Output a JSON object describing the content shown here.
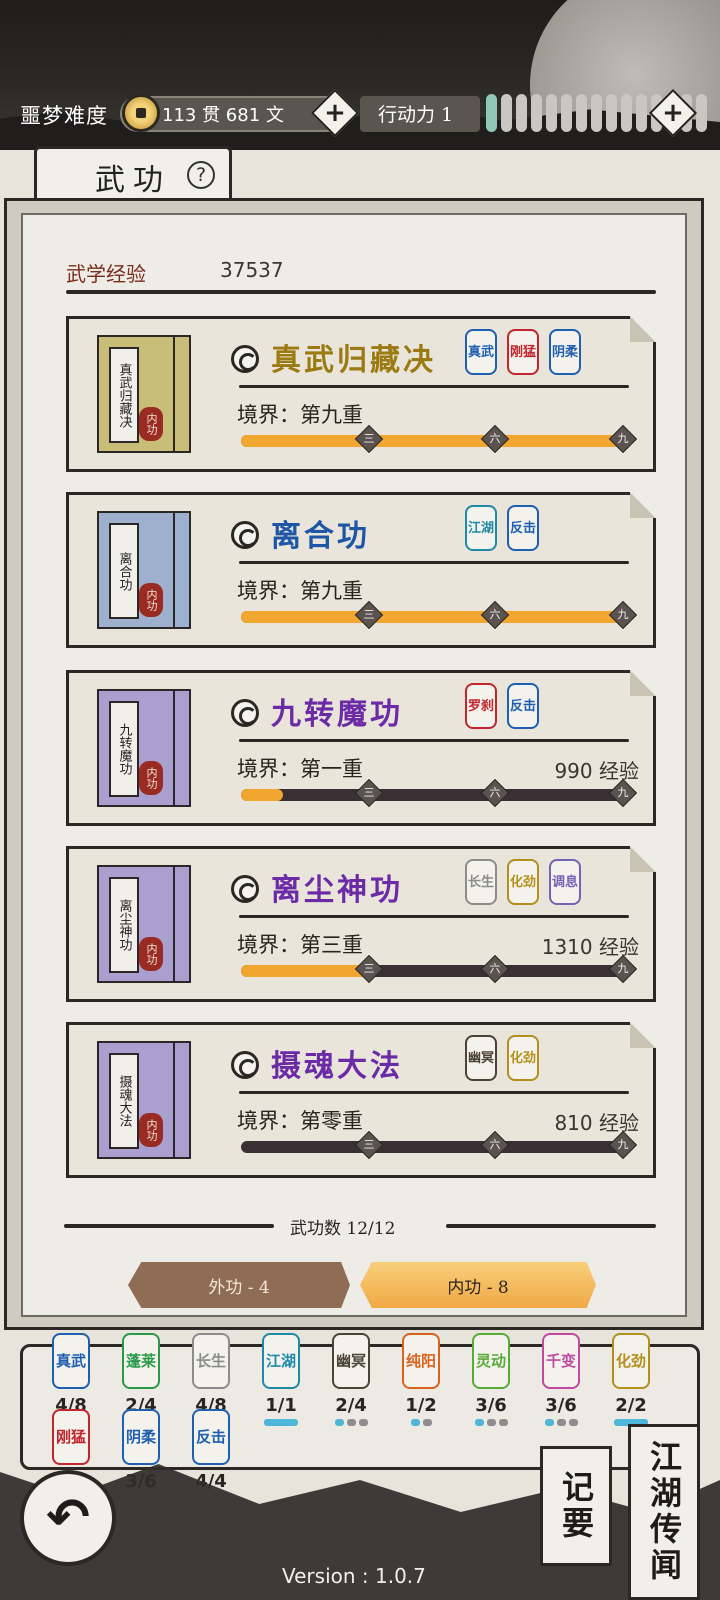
{
  "status": {
    "difficulty": "噩梦难度",
    "currency": "113 贯  681  文",
    "action_label": "行动力 1",
    "energy_total": 15,
    "energy_filled": 1
  },
  "page": {
    "title": "武功",
    "help_glyph": "?"
  },
  "experience": {
    "label": "武学经验",
    "value": "37537"
  },
  "realm_label": "境界：",
  "marks": [
    "三",
    "六",
    "九"
  ],
  "skills": [
    {
      "name": "真武归藏决",
      "name_color": "#9b7a12",
      "book_label": "真武归藏决",
      "book_color": "#c9bd7a",
      "seal": "内功",
      "realm": "第九重",
      "exp": "",
      "exp_unit": "",
      "progress": 1.0,
      "tags": [
        {
          "text": "真武",
          "color": "#1f5fb0"
        },
        {
          "text": "刚猛",
          "color": "#c0262c"
        },
        {
          "text": "阴柔",
          "color": "#1f5fb0"
        }
      ]
    },
    {
      "name": "离合功",
      "name_color": "#1d56a6",
      "book_label": "离合功",
      "book_color": "#9db1cf",
      "seal": "内功",
      "realm": "第九重",
      "exp": "",
      "exp_unit": "",
      "progress": 1.0,
      "tags": [
        {
          "text": "江湖",
          "color": "#1f8aa8"
        },
        {
          "text": "反击",
          "color": "#1f5fb0"
        }
      ]
    },
    {
      "name": "九转魔功",
      "name_color": "#6b2aa6",
      "book_label": "九转魔功",
      "book_color": "#aaa0cf",
      "seal": "内功",
      "realm": "第一重",
      "exp": "990",
      "exp_unit": " 经验",
      "progress": 0.11,
      "tags": [
        {
          "text": "罗刹",
          "color": "#c0262c"
        },
        {
          "text": "反击",
          "color": "#1f5fb0"
        }
      ]
    },
    {
      "name": "离尘神功",
      "name_color": "#6b2aa6",
      "book_label": "离尘神功",
      "book_color": "#aaa0cf",
      "seal": "内功",
      "realm": "第三重",
      "exp": "1310",
      "exp_unit": " 经验",
      "progress": 0.33,
      "tags": [
        {
          "text": "长生",
          "color": "#8c8c8c"
        },
        {
          "text": "化劲",
          "color": "#b38f1d"
        },
        {
          "text": "调息",
          "color": "#7563b5"
        }
      ]
    },
    {
      "name": "摄魂大法",
      "name_color": "#6b2aa6",
      "book_label": "摄魂大法",
      "book_color": "#aaa0cf",
      "seal": "内功",
      "realm": "第零重",
      "exp": "810",
      "exp_unit": " 经验",
      "progress": 0.0,
      "tags": [
        {
          "text": "幽冥",
          "color": "#4a4336"
        },
        {
          "text": "化劲",
          "color": "#b38f1d"
        }
      ]
    }
  ],
  "skill_count": "武功数 12/12",
  "tabs": {
    "outer": "外功 - 4",
    "inner": "内功 - 8"
  },
  "categories": [
    {
      "text": "真武",
      "color": "#1f5fb0",
      "frac": "4/8",
      "on": 0,
      "total": 0
    },
    {
      "text": "蓬莱",
      "color": "#2a9a4a",
      "frac": "2/4",
      "on": 0,
      "total": 0
    },
    {
      "text": "长生",
      "color": "#8c8c8c",
      "frac": "4/8",
      "on": 0,
      "total": 0
    },
    {
      "text": "江湖",
      "color": "#1f8aa8",
      "frac": "1/1",
      "on": 1,
      "total": 1
    },
    {
      "text": "幽冥",
      "color": "#4a4336",
      "frac": "2/4",
      "on": 1,
      "total": 3
    },
    {
      "text": "纯阳",
      "color": "#d9621e",
      "frac": "1/2",
      "on": 1,
      "total": 2
    },
    {
      "text": "灵动",
      "color": "#5aaa3a",
      "frac": "3/6",
      "on": 1,
      "total": 3
    },
    {
      "text": "千变",
      "color": "#c04aa0",
      "frac": "3/6",
      "on": 1,
      "total": 3
    },
    {
      "text": "化劲",
      "color": "#b38f1d",
      "frac": "2/2",
      "on": 1,
      "total": 1
    },
    {
      "text": "刚猛",
      "color": "#c0262c",
      "frac": "",
      "on": 0,
      "total": 0
    },
    {
      "text": "阴柔",
      "color": "#1f5fb0",
      "frac": "3/6",
      "on": 0,
      "total": 0
    },
    {
      "text": "反击",
      "color": "#1f5fb0",
      "frac": "4/4",
      "on": 0,
      "total": 0
    }
  ],
  "side_cards": {
    "journal": "记要",
    "rumors": "江湖传闻"
  },
  "back_glyph": "↶",
  "version": "Version : 1.0.7"
}
